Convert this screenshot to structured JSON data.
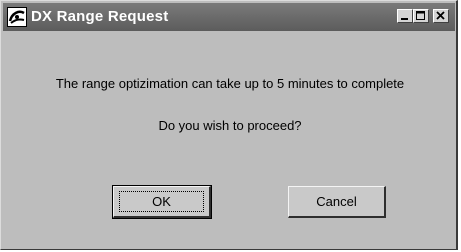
{
  "window": {
    "title": "DX Range Request",
    "app_icon": "dx-app-icon",
    "controls": {
      "minimize_icon": "minimize-icon",
      "maximize_icon": "maximize-icon",
      "close_icon": "close-icon"
    }
  },
  "dialog": {
    "message": "The range optizimation can take up to 5 minutes to complete",
    "question": "Do you wish to proceed?"
  },
  "buttons": {
    "ok_label": "OK",
    "cancel_label": "Cancel"
  },
  "colors": {
    "dialog_face": "#bdbdbd",
    "titlebar": "#6b6b6b",
    "title_text": "#ffffff"
  }
}
